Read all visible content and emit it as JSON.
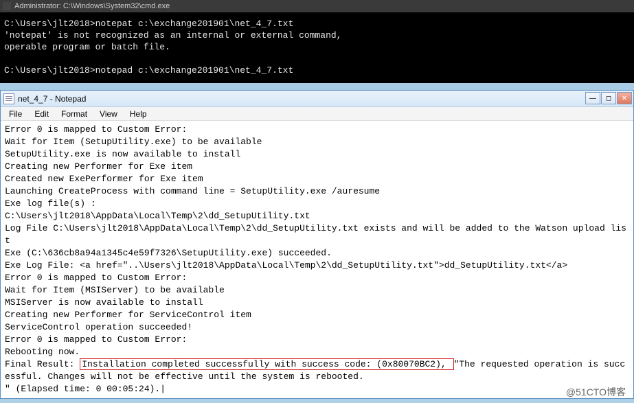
{
  "cmd": {
    "title": "Administrator: C:\\Windows\\System32\\cmd.exe",
    "line1": "C:\\Users\\jlt2018>notepat c:\\exchange201901\\net_4_7.txt",
    "line2": "'notepat' is not recognized as an internal or external command,",
    "line3": "operable program or batch file.",
    "line4": "C:\\Users\\jlt2018>notepad c:\\exchange201901\\net_4_7.txt"
  },
  "notepad": {
    "title": "net_4_7 - Notepad",
    "menu": {
      "file": "File",
      "edit": "Edit",
      "format": "Format",
      "view": "View",
      "help": "Help"
    },
    "lines": {
      "l1": "Error 0 is mapped to Custom Error:",
      "l2": "Wait for Item (SetupUtility.exe) to be available",
      "l3": "SetupUtility.exe is now available to install",
      "l4": "Creating new Performer for Exe item",
      "l5": "Created new ExePerformer for Exe item",
      "l6": "Launching CreateProcess with command line = SetupUtility.exe /auresume",
      "l7": "Exe log file(s) :",
      "l8": "C:\\Users\\jlt2018\\AppData\\Local\\Temp\\2\\dd_SetupUtility.txt",
      "l9": "Log File C:\\Users\\jlt2018\\AppData\\Local\\Temp\\2\\dd_SetupUtility.txt exists and will be added to the Watson upload list",
      "l10": "Exe (C:\\636cb8a94a1345c4e59f7326\\SetupUtility.exe) succeeded.",
      "l11": "Exe Log File: <a href=\"..\\Users\\jlt2018\\AppData\\Local\\Temp\\2\\dd_SetupUtility.txt\">dd_SetupUtility.txt</a>",
      "l12": "Error 0 is mapped to Custom Error:",
      "l13": "Wait for Item (MSIServer) to be available",
      "l14": "MSIServer is now available to install",
      "l15": "Creating new Performer for ServiceControl item",
      "l16": "ServiceControl operation succeeded!",
      "l17": "Error 0 is mapped to Custom Error:",
      "l18": "Rebooting now.",
      "l19a": "Final Result: ",
      "l19b": "Installation completed successfully with success code: (0x80070BC2), ",
      "l19c": "\"The requested operation is successful. Changes will not be effective until the system is rebooted.",
      "l20": "\" (Elapsed time: 0 00:05:24)."
    }
  },
  "watermark": "@51CTO博客"
}
